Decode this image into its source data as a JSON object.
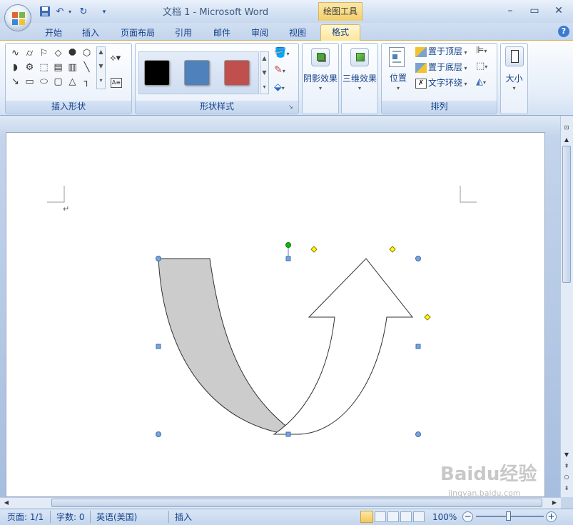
{
  "window": {
    "title": "文档 1 - Microsoft Word",
    "context_tab": "绘图工具",
    "minimize": "–",
    "maximize": "▭",
    "close": "✕"
  },
  "qat": {
    "save_icon": "save-icon",
    "undo_icon": "undo-icon",
    "redo_icon": "redo-icon",
    "customize_icon": "customize-icon"
  },
  "tabs": [
    "开始",
    "插入",
    "页面布局",
    "引用",
    "邮件",
    "审阅",
    "视图",
    "格式"
  ],
  "active_tab": "格式",
  "help_label": "?",
  "ribbon": {
    "insert_shapes": {
      "label": "插入形状"
    },
    "shape_styles": {
      "label": "形状样式",
      "swatches": [
        "#000000",
        "#4f81bd",
        "#c0504d"
      ]
    },
    "shadow_effects": {
      "label": "阴影效果"
    },
    "threed_effects": {
      "label": "三维效果"
    },
    "arrange": {
      "label": "排列",
      "position_label": "位置",
      "bring_front": "置于顶层",
      "send_back": "置于底层",
      "text_wrap": "文字环绕"
    },
    "size": {
      "label": "大小"
    }
  },
  "document": {
    "paragraph_mark": "↵"
  },
  "status": {
    "page": "页面: 1/1",
    "words": "字数: 0",
    "language": "英语(美国)",
    "mode": "插入",
    "zoom": "100%",
    "zoom_minus": "−",
    "zoom_plus": "+"
  },
  "watermark": {
    "text": "Baidu经验",
    "url": "jingyan.baidu.com"
  },
  "colors": {
    "shape_fill": "#cccccc",
    "handle_blue": "#4f81bd",
    "handle_yellow": "#ffff00",
    "handle_green": "#00c000"
  }
}
